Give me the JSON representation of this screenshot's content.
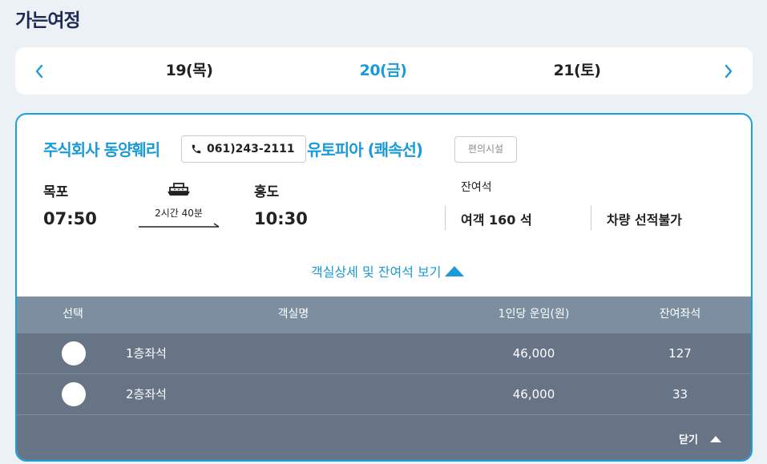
{
  "page": {
    "title": "가는여정"
  },
  "date_nav": {
    "prev_icon": "chevron-left-icon",
    "next_icon": "chevron-right-icon",
    "days": [
      {
        "label": "19(목)",
        "selected": false
      },
      {
        "label": "20(금)",
        "selected": true
      },
      {
        "label": "21(토)",
        "selected": false
      }
    ]
  },
  "sailing": {
    "company": "주식회사 동양훼리",
    "phone": "061)243-2111",
    "ship_name": "유토피아 (쾌속선)",
    "facility_label": "편의시설",
    "departure": {
      "port": "목포",
      "time": "07:50"
    },
    "arrival": {
      "port": "홍도",
      "time": "10:30"
    },
    "duration": "2시간 40분",
    "remaining_label": "잔여석",
    "passenger_remaining": "여객 160 석",
    "vehicle_remaining": "차량 선적불가",
    "detail_toggle": "객실상세 및 잔여석 보기"
  },
  "cabins": {
    "headers": [
      "선택",
      "객실명",
      "1인당 운임(원)",
      "잔여좌석"
    ],
    "rows": [
      {
        "name": "1층좌석",
        "fare": "46,000",
        "seats": "127"
      },
      {
        "name": "2층좌석",
        "fare": "46,000",
        "seats": "33"
      }
    ],
    "close_label": "닫기"
  },
  "colors": {
    "accent": "#1a9bd7",
    "title": "#1f2a52",
    "table_header": "#7b8fa1",
    "table_body": "#667486"
  }
}
